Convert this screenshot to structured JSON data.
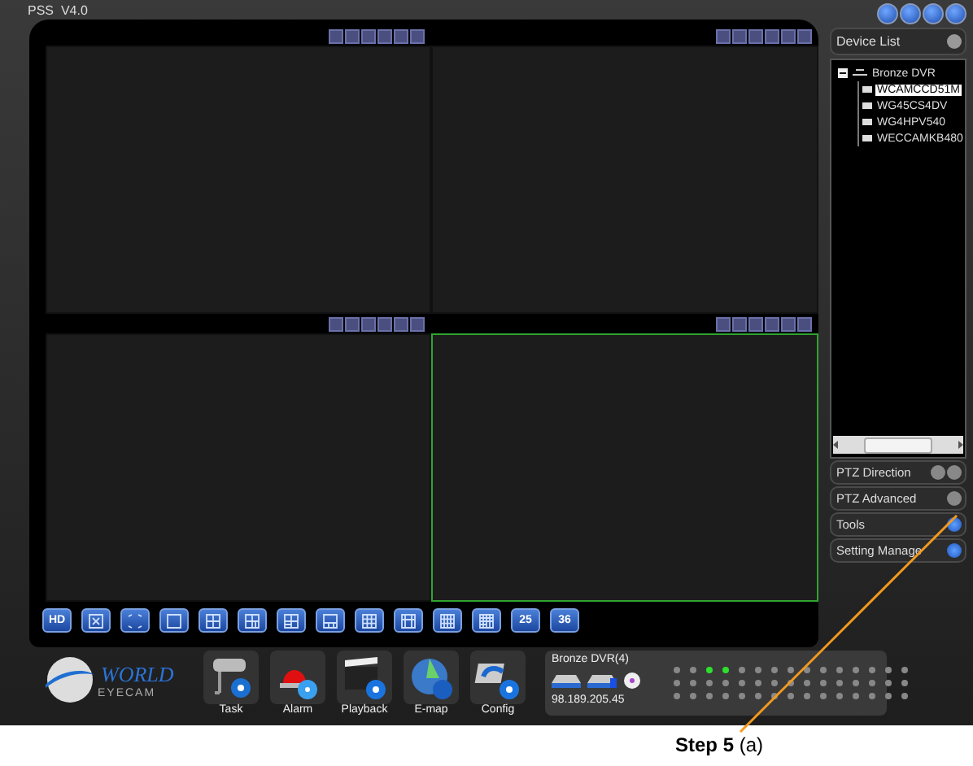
{
  "window": {
    "title": "PSS  V4.0"
  },
  "panes": [
    {
      "selected": false
    },
    {
      "selected": false
    },
    {
      "selected": false
    },
    {
      "selected": true
    }
  ],
  "layout_buttons": [
    {
      "kind": "text",
      "label": "HD"
    },
    {
      "kind": "icon"
    },
    {
      "kind": "icon"
    },
    {
      "kind": "icon"
    },
    {
      "kind": "icon"
    },
    {
      "kind": "icon"
    },
    {
      "kind": "icon"
    },
    {
      "kind": "icon"
    },
    {
      "kind": "icon"
    },
    {
      "kind": "icon"
    },
    {
      "kind": "icon"
    },
    {
      "kind": "icon"
    },
    {
      "kind": "text",
      "label": "25"
    },
    {
      "kind": "text",
      "label": "36"
    }
  ],
  "sidebar": {
    "device_list": {
      "title": "Device List"
    },
    "tree": [
      {
        "label": "Bronze DVR",
        "expanded": true,
        "children": [
          {
            "label": "WCAMCCD51M",
            "selected": true
          },
          {
            "label": "WG45CS4DV",
            "selected": false
          },
          {
            "label": "WG4HPV540",
            "selected": false
          },
          {
            "label": "WECCAMKB480",
            "selected": false
          }
        ]
      }
    ],
    "sections": [
      {
        "label": "PTZ Direction",
        "kind": "pair",
        "highlighted": false
      },
      {
        "label": "PTZ Advanced",
        "kind": "single",
        "highlighted": false
      },
      {
        "label": "Tools",
        "kind": "single",
        "highlighted": true
      },
      {
        "label": "Setting Manage",
        "kind": "single",
        "highlighted": true
      }
    ]
  },
  "logo": {
    "line1": "WORLD",
    "line2": "EYECAM"
  },
  "toolbar": [
    {
      "kind": "task",
      "label": "Task"
    },
    {
      "kind": "alarm",
      "label": "Alarm"
    },
    {
      "kind": "playback",
      "label": "Playback"
    },
    {
      "kind": "emap",
      "label": "E-map"
    },
    {
      "kind": "config",
      "label": "Config"
    }
  ],
  "device_status": {
    "name": "Bronze DVR(4)",
    "address": "98.189.205.45",
    "indicator_rows": [
      [
        false,
        false,
        true,
        true,
        false,
        false,
        false,
        false,
        false,
        false,
        false,
        false,
        false,
        false,
        false
      ],
      [
        false,
        false,
        false,
        false,
        false,
        false,
        false,
        false,
        false,
        false,
        false,
        false,
        false,
        false,
        false
      ],
      [
        false,
        false,
        false,
        false,
        false,
        false,
        false,
        false,
        false,
        false,
        false,
        false,
        false,
        false,
        false
      ]
    ]
  },
  "callout": {
    "text": "**Step 5** (a)"
  }
}
